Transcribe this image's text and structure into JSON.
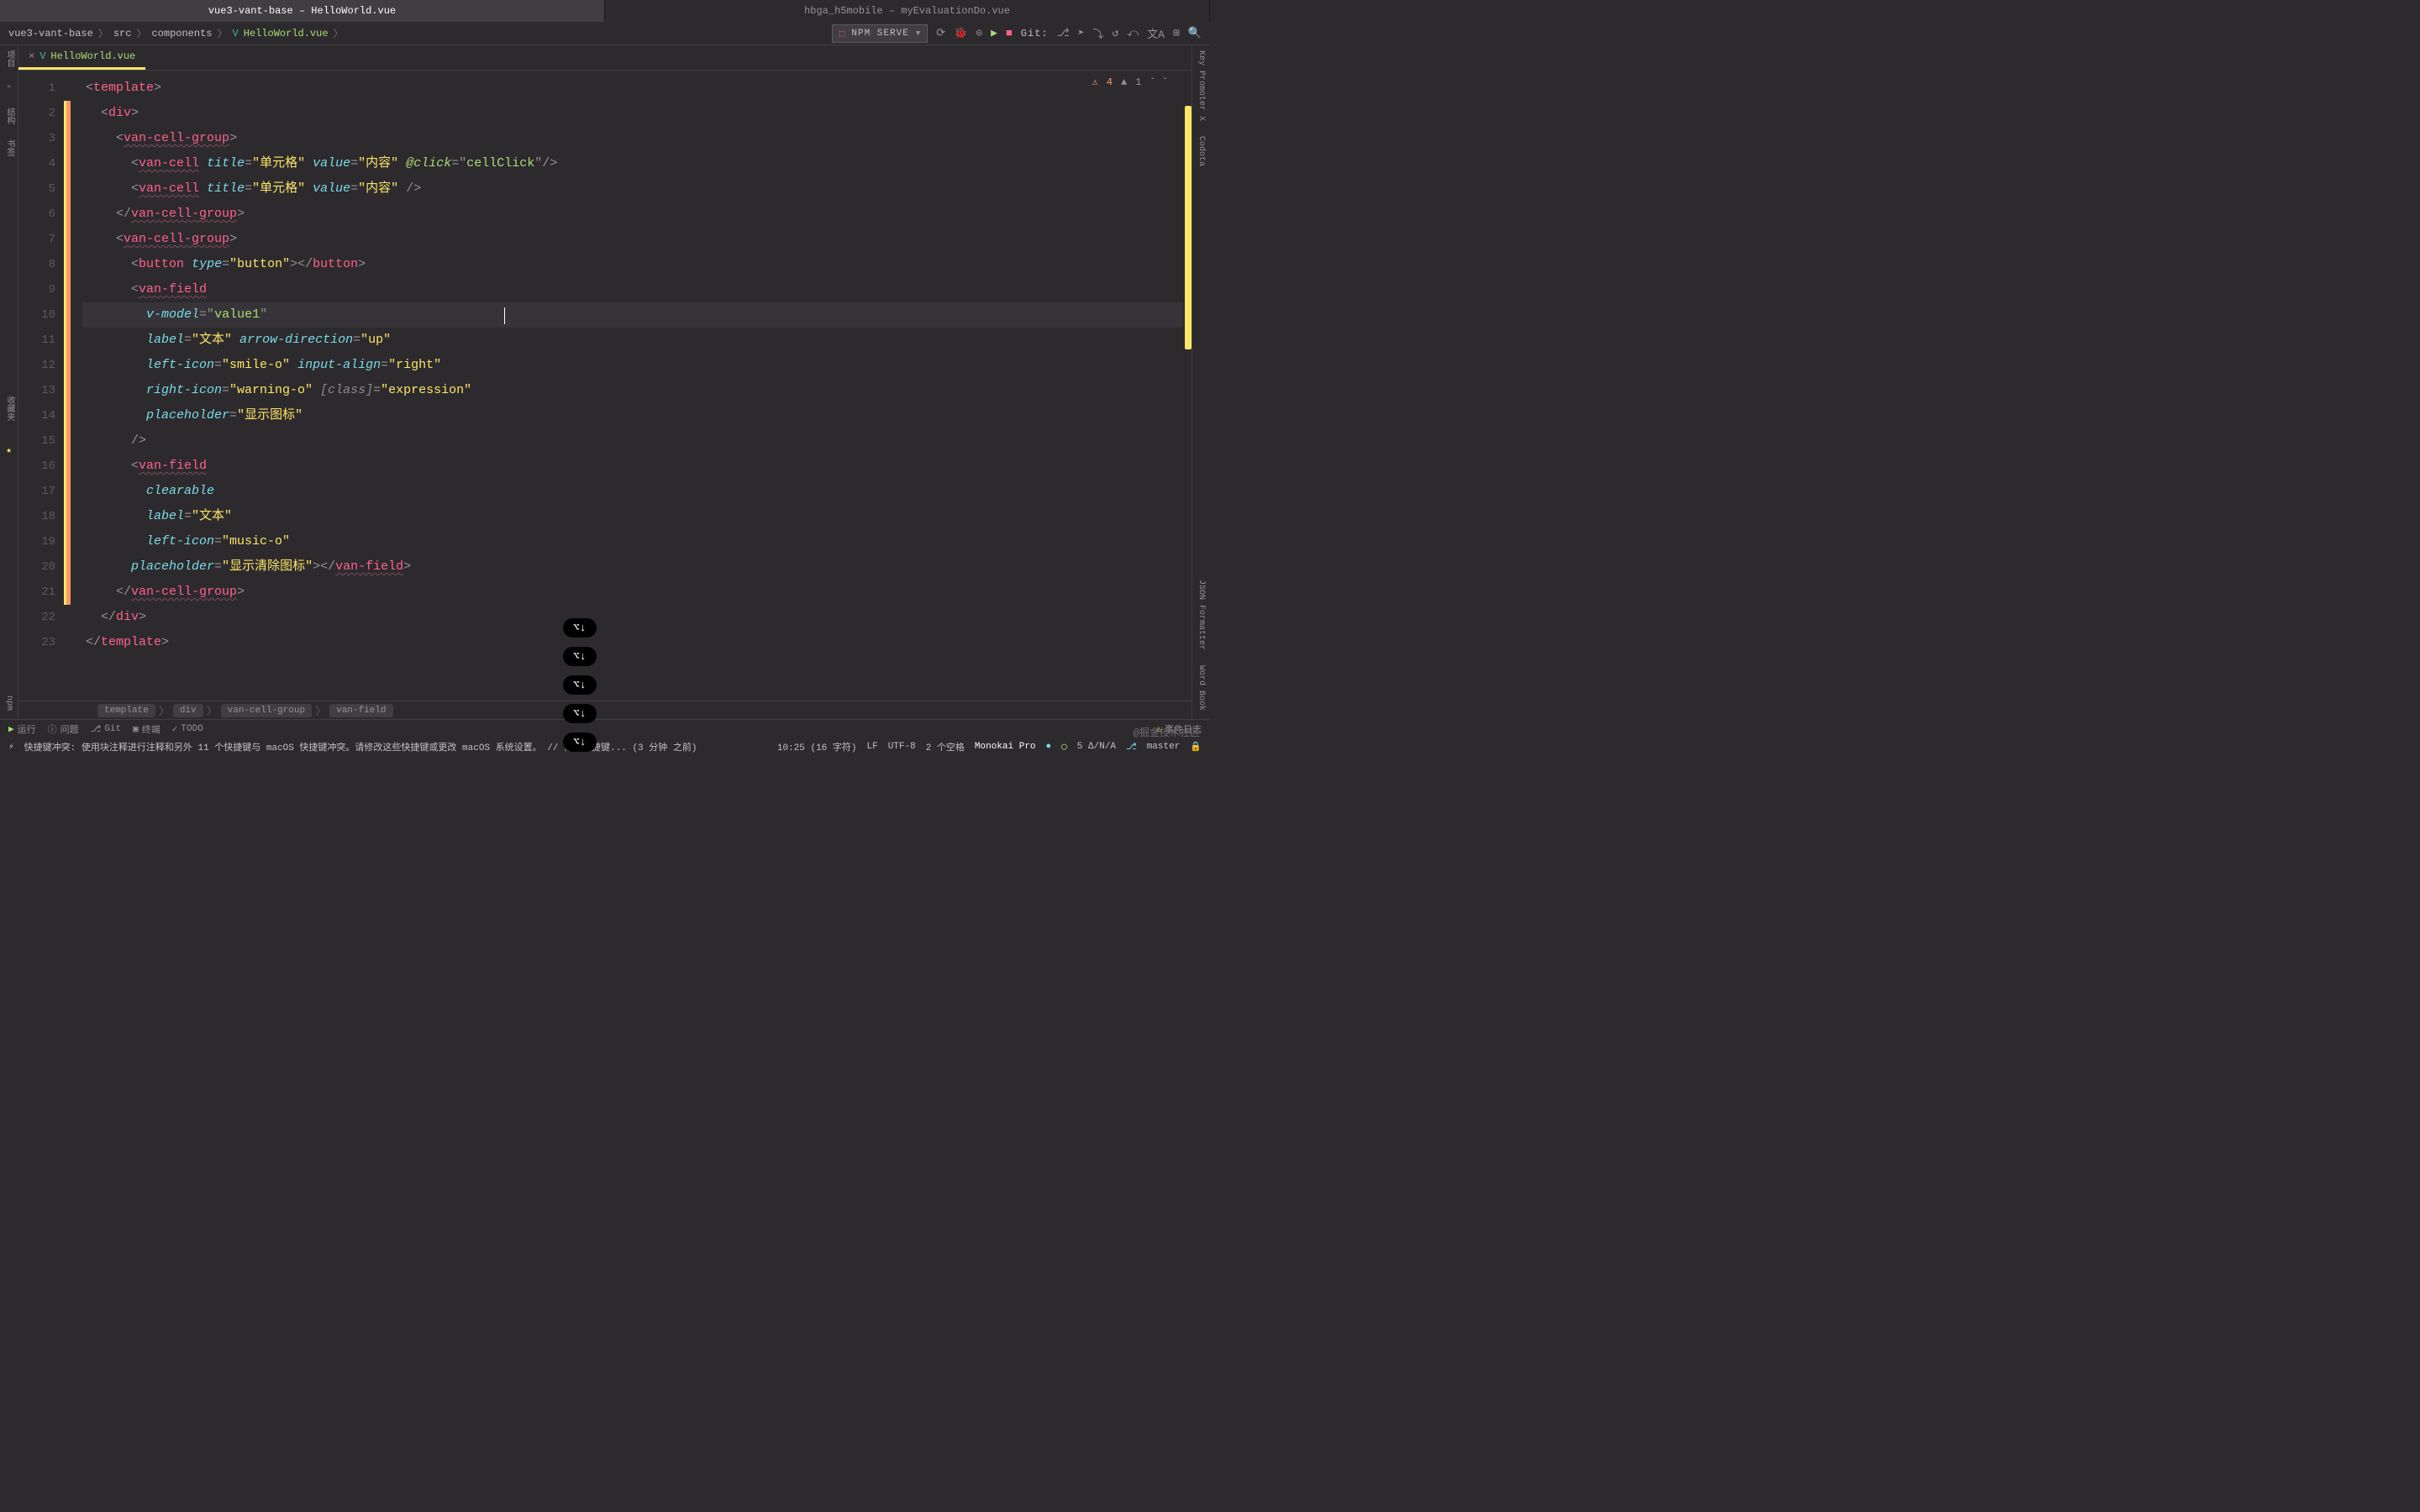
{
  "title_tabs": [
    {
      "project": "vue3-vant-base",
      "file": "HelloWorld.vue",
      "active": true
    },
    {
      "project": "hbga_h5mobile",
      "file": "myEvaluationDo.vue",
      "active": false
    }
  ],
  "breadcrumbs": {
    "parts": [
      "vue3-vant-base",
      "src",
      "components",
      "HelloWorld.vue"
    ],
    "sep": "〉"
  },
  "toolbar": {
    "npm_label": "NPM SERVE",
    "git_label": "Git:"
  },
  "file_tab": {
    "name": "HelloWorld.vue"
  },
  "warnings": {
    "count": "4",
    "weak": "1"
  },
  "code_lines": [
    {
      "n": "1",
      "html": "<span class='punct'>&lt;</span><span class='tag'>template</span><span class='punct'>&gt;</span>"
    },
    {
      "n": "2",
      "html": "  <span class='punct'>&lt;</span><span class='tag'>div</span><span class='punct'>&gt;</span>"
    },
    {
      "n": "3",
      "html": "    <span class='punct'>&lt;</span><span class='custom-tag'>van-cell-group</span><span class='punct'>&gt;</span>"
    },
    {
      "n": "4",
      "html": "      <span class='punct'>&lt;</span><span class='custom-tag'>van-cell</span> <span class='attr'>title</span><span class='punct'>=</span><span class='string'>\"单元格\"</span> <span class='attr'>value</span><span class='punct'>=</span><span class='string'>\"内容\"</span> <span class='attr-event'>@click</span><span class='punct'>=</span><span class='punct'>\"</span><span class='string-fn'>cellClick</span><span class='punct'>\"</span><span class='punct'>/&gt;</span>"
    },
    {
      "n": "5",
      "html": "      <span class='punct'>&lt;</span><span class='custom-tag'>van-cell</span> <span class='attr'>title</span><span class='punct'>=</span><span class='string'>\"单元格\"</span> <span class='attr'>value</span><span class='punct'>=</span><span class='string'>\"内容\"</span> <span class='punct'>/&gt;</span>"
    },
    {
      "n": "6",
      "html": "    <span class='punct'>&lt;/</span><span class='custom-tag'>van-cell-group</span><span class='punct'>&gt;</span>"
    },
    {
      "n": "7",
      "html": "    <span class='punct'>&lt;</span><span class='custom-tag'>van-cell-group</span><span class='punct'>&gt;</span>"
    },
    {
      "n": "8",
      "html": "      <span class='punct'>&lt;</span><span class='tag'>button</span> <span class='attr'>type</span><span class='punct'>=</span><span class='string'>\"button\"</span><span class='punct'>&gt;&lt;/</span><span class='tag'>button</span><span class='punct'>&gt;</span>"
    },
    {
      "n": "9",
      "html": "      <span class='punct'>&lt;</span><span class='custom-tag'>van-field</span>"
    },
    {
      "n": "10",
      "active": true,
      "html": "        <span class='attr'>v-model</span><span class='punct'>=</span><span class='punct'>\"</span><span class='string-fn'>value1</span><span class='punct'>\"</span><span style='position:relative'><span class='cursor-line'></span></span>"
    },
    {
      "n": "11",
      "html": "        <span class='attr'>label</span><span class='punct'>=</span><span class='string'>\"文本\"</span> <span class='attr'>arrow-direction</span><span class='punct'>=</span><span class='string'>\"up\"</span>"
    },
    {
      "n": "12",
      "html": "        <span class='attr'>left-icon</span><span class='punct'>=</span><span class='string'>\"smile-o\"</span> <span class='attr'>input-align</span><span class='punct'>=</span><span class='string'>\"right\"</span>"
    },
    {
      "n": "13",
      "html": "        <span class='attr'>right-icon</span><span class='punct'>=</span><span class='string'>\"warning-o\"</span> <span class='bracket-attr'>[class]</span><span class='punct'>=</span><span class='string'>\"expression\"</span>"
    },
    {
      "n": "14",
      "html": "        <span class='attr'>placeholder</span><span class='punct'>=</span><span class='string'>\"显示图标\"</span>"
    },
    {
      "n": "15",
      "html": "      <span class='punct'>/&gt;</span>"
    },
    {
      "n": "16",
      "html": "      <span class='punct'>&lt;</span><span class='custom-tag'>van-field</span>"
    },
    {
      "n": "17",
      "html": "        <span class='attr'>clearable</span>"
    },
    {
      "n": "18",
      "html": "        <span class='attr'>label</span><span class='punct'>=</span><span class='string'>\"文本\"</span>"
    },
    {
      "n": "19",
      "html": "        <span class='attr'>left-icon</span><span class='punct'>=</span><span class='string'>\"music-o\"</span>"
    },
    {
      "n": "20",
      "html": "      <span class='attr'>placeholder</span><span class='punct'>=</span><span class='string'>\"显示清除图标\"</span><span class='punct'>&gt;&lt;/</span><span class='custom-tag'>van-field</span><span class='punct'>&gt;</span>"
    },
    {
      "n": "21",
      "html": "    <span class='punct'>&lt;/</span><span class='custom-tag'>van-cell-group</span><span class='punct'>&gt;</span>"
    },
    {
      "n": "22",
      "html": "  <span class='punct'>&lt;/</span><span class='tag'>div</span><span class='punct'>&gt;</span>"
    },
    {
      "n": "23",
      "html": "<span class='punct'>&lt;/</span><span class='tag'>template</span><span class='punct'>&gt;</span>"
    }
  ],
  "bottom_crumbs": [
    "template",
    "div",
    "van-cell-group",
    "van-field"
  ],
  "bottom_bar": {
    "run": "运行",
    "problems": "问题",
    "git": "Git",
    "terminal": "终端",
    "todo": "TODO",
    "eventlog": "事件日志"
  },
  "status": {
    "msg": "快捷键冲突:  使用块注释进行注释和另外 11 个快捷键与 macOS 快捷键冲突。请修改这些快捷键或更改 macOS 系统设置。 // 修改快捷键... (3 分钟 之前)",
    "pos": "10:25 (16 字符)",
    "lf": "LF",
    "enc": "UTF-8",
    "indent": "2 个空格",
    "theme": "Monokai Pro",
    "coverage": "5 Δ/N/A",
    "branch": "master"
  },
  "pills": [
    "⌥↓",
    "⌥↓",
    "⌥↓",
    "⌥↓",
    "⌥↓"
  ],
  "left_panels": {
    "project": "项目",
    "structure": "结构",
    "bookmarks": "书签",
    "favorites": "收藏夹",
    "npm": "npm"
  },
  "right_panels": {
    "keypromoter": "Key Promoter X",
    "codota": "Codota",
    "jsonformatter": "JSON Formatter",
    "wordbook": "Word Book"
  },
  "watermark": "@掘金技术社区"
}
